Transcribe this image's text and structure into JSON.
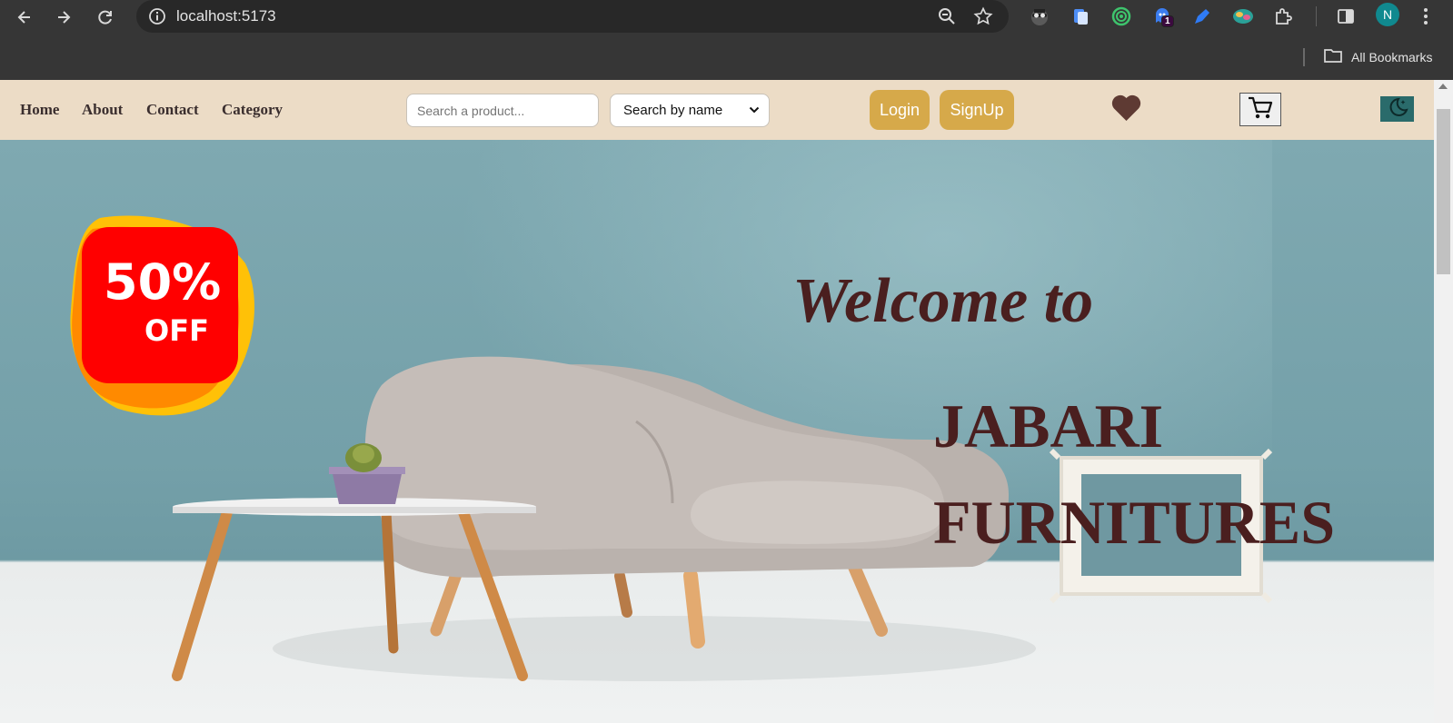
{
  "browser": {
    "url": "localhost:5173",
    "profile_initial": "N",
    "extension_badge": "1",
    "bookmarks_label": "All Bookmarks"
  },
  "navbar": {
    "links": [
      "Home",
      "About",
      "Contact",
      "Category"
    ],
    "search_placeholder": "Search a product...",
    "search_mode": "Search by name",
    "login_label": "Login",
    "signup_label": "SignUp",
    "colors": {
      "bar": "#ecdcc6",
      "button": "#d6a94a",
      "theme_toggle": "#2a6b6b"
    }
  },
  "hero": {
    "welcome": "Welcome to",
    "brand_line1": "JABARI",
    "brand_line2": "FURNITURES",
    "sale_percent": "50%",
    "sale_off": "OFF",
    "colors": {
      "headline": "#4a1f1f",
      "wall": "#7fa9b1",
      "sale_badge": "#ff0000"
    }
  }
}
